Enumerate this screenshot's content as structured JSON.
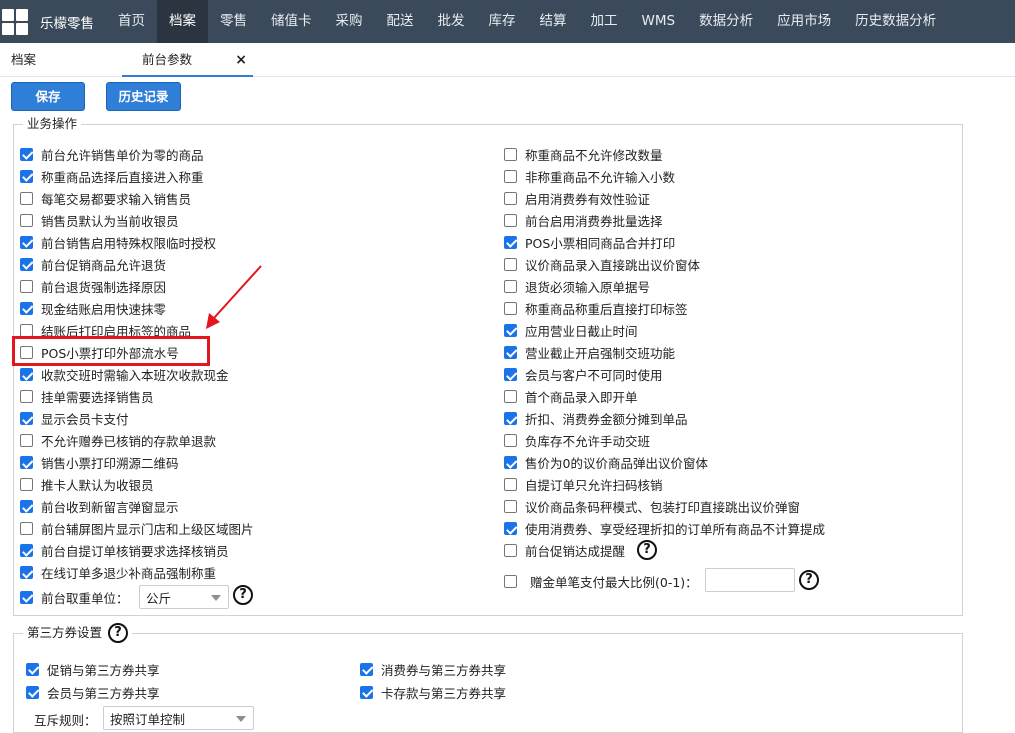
{
  "topnav": {
    "brand": "乐檬零售",
    "items": [
      "首页",
      "档案",
      "零售",
      "储值卡",
      "采购",
      "配送",
      "批发",
      "库存",
      "结算",
      "加工",
      "WMS",
      "数据分析",
      "应用市场",
      "历史数据分析"
    ],
    "active_index": 1
  },
  "tabs": {
    "archive": "档案",
    "front": "前台参数",
    "close": "×"
  },
  "toolbar": {
    "save": "保存",
    "history": "历史记录"
  },
  "business": {
    "legend": "业务操作",
    "left": [
      {
        "label": "前台允许销售单价为零的商品",
        "checked": true
      },
      {
        "label": "称重商品选择后直接进入称重",
        "checked": true
      },
      {
        "label": "每笔交易都要求输入销售员",
        "checked": false
      },
      {
        "label": "销售员默认为当前收银员",
        "checked": false
      },
      {
        "label": "前台销售启用特殊权限临时授权",
        "checked": true
      },
      {
        "label": "前台促销商品允许退货",
        "checked": true
      },
      {
        "label": "前台退货强制选择原因",
        "checked": false
      },
      {
        "label": "现金结账启用快速抹零",
        "checked": true
      },
      {
        "label": "结账后打印启用标签的商品",
        "checked": false
      },
      {
        "label": "POS小票打印外部流水号",
        "checked": false
      },
      {
        "label": "收款交班时需输入本班次收款现金",
        "checked": true
      },
      {
        "label": "挂单需要选择销售员",
        "checked": false
      },
      {
        "label": "显示会员卡支付",
        "checked": true
      },
      {
        "label": "不允许赠券已核销的存款单退款",
        "checked": false
      },
      {
        "label": "销售小票打印溯源二维码",
        "checked": true
      },
      {
        "label": "推卡人默认为收银员",
        "checked": false
      },
      {
        "label": "前台收到新留言弹窗显示",
        "checked": true
      },
      {
        "label": "前台辅屏图片显示门店和上级区域图片",
        "checked": false
      },
      {
        "label": "前台自提订单核销要求选择核销员",
        "checked": true
      },
      {
        "label": "在线订单多退少补商品强制称重",
        "checked": true
      }
    ],
    "weigh_unit": {
      "label": "前台取重单位：",
      "checked": true,
      "value": "公斤"
    },
    "right": [
      {
        "label": "称重商品不允许修改数量",
        "checked": false
      },
      {
        "label": "非称重商品不允许输入小数",
        "checked": false
      },
      {
        "label": "启用消费券有效性验证",
        "checked": false
      },
      {
        "label": "前台启用消费券批量选择",
        "checked": false
      },
      {
        "label": "POS小票相同商品合并打印",
        "checked": true
      },
      {
        "label": "议价商品录入直接跳出议价窗体",
        "checked": false
      },
      {
        "label": "退货必须输入原单据号",
        "checked": false
      },
      {
        "label": "称重商品称重后直接打印标签",
        "checked": false
      },
      {
        "label": "应用营业日截止时间",
        "checked": true
      },
      {
        "label": "营业截止开启强制交班功能",
        "checked": true
      },
      {
        "label": "会员与客户不可同时使用",
        "checked": true
      },
      {
        "label": "首个商品录入即开单",
        "checked": false
      },
      {
        "label": "折扣、消费券金额分摊到单品",
        "checked": true
      },
      {
        "label": "负库存不允许手动交班",
        "checked": false
      },
      {
        "label": "售价为0的议价商品弹出议价窗体",
        "checked": true
      },
      {
        "label": "自提订单只允许扫码核销",
        "checked": false
      },
      {
        "label": "议价商品条码秤模式、包装打印直接跳出议价弹窗",
        "checked": false
      },
      {
        "label": "使用消费券、享受经理折扣的订单所有商品不计算提成",
        "checked": true
      }
    ],
    "promo_hint": {
      "label": "前台促销达成提醒",
      "checked": false
    },
    "gift_ratio": {
      "label": "赠金单笔支付最大比例(0-1)：",
      "checked": false,
      "value": ""
    }
  },
  "third_party": {
    "legend": "第三方券设置",
    "items": [
      {
        "label": "促销与第三方券共享",
        "checked": true
      },
      {
        "label": "消费券与第三方券共享",
        "checked": true
      },
      {
        "label": "会员与第三方券共享",
        "checked": true
      },
      {
        "label": "卡存款与第三方券共享",
        "checked": true
      }
    ],
    "rule": {
      "label": "互斥规则：",
      "value": "按照订单控制"
    }
  },
  "help_symbol": "?",
  "annotation": {
    "color": "#e4151c"
  }
}
